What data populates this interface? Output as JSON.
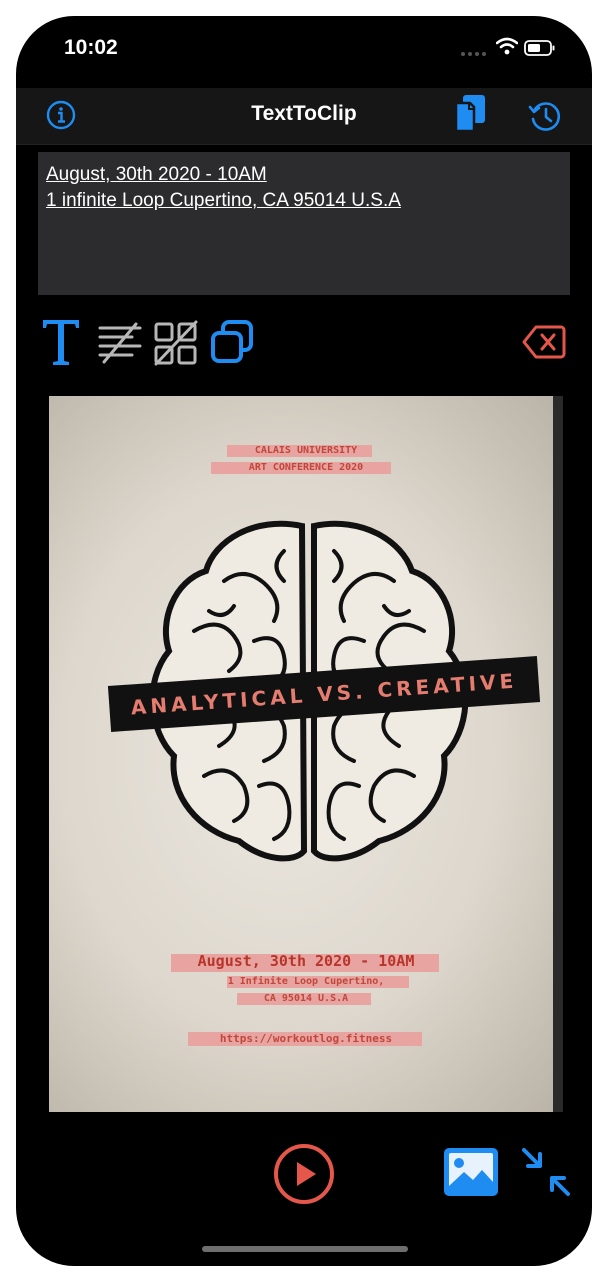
{
  "status_bar": {
    "time": "10:02"
  },
  "nav": {
    "title": "TextToClip",
    "left_icon": "info-icon",
    "right_icons": [
      "copy-icon",
      "history-icon"
    ]
  },
  "recognized_text": {
    "lines": [
      "August, 30th 2020 - 10AM",
      "1 infinite Loop Cupertino, CA 95014 U.S.A"
    ]
  },
  "toolbar": {
    "icons": [
      "text-mode-icon",
      "lines-mode-icon",
      "qr-mode-icon",
      "multi-select-icon"
    ],
    "clear_icon": "delete-icon"
  },
  "photo": {
    "header_line1": "CALAIS UNIVERSITY",
    "header_line2": "ART CONFERENCE 2020",
    "banner": "ANALYTICAL VS. CREATIVE",
    "date": "August, 30th 2020 - 10AM",
    "address_line1": "1 Infinite Loop Cupertino,",
    "address_line2": "CA 95014 U.S.A",
    "url": "https://workoutlog.fitness"
  },
  "bottom_bar": {
    "icons": [
      "play-icon",
      "photo-library-icon",
      "collapse-icon"
    ]
  },
  "colors": {
    "accent_blue": "#1e8cf0",
    "accent_red": "#e4574a",
    "background": "#000000",
    "textbox": "#2c2c2e"
  }
}
